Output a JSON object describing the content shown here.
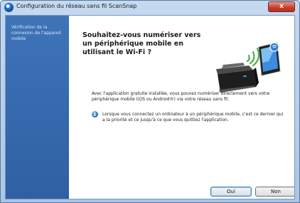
{
  "window": {
    "title": "Configuration du réseau sans fil ScanSnap",
    "close_label": "x"
  },
  "sidebar": {
    "items": [
      {
        "label": "Vérification de la connexion de l'appareil mobile"
      }
    ]
  },
  "main": {
    "heading": "Souhaitez-vous numériser vers un périphérique mobile en utilisant le Wi-Fi ?",
    "paragraph": "Avec l'application gratuite installée, vous pouvez numériser directement vers votre périphérique mobile (iOS ou Android®) via votre réseau sans fil.",
    "info_text": "Lorsque vous connectez un ordinateur à un périphérique mobile, c'est ce dernier qui a la priorité et ce jusqu'à ce que vous quittiez l'application.",
    "info_icon_glyph": "i",
    "illustration": {
      "icons": [
        "scanner-icon",
        "wifi-waves-icon",
        "tablet-icon"
      ],
      "colors": {
        "scanner": "#2b2b2b",
        "wifi": "#4db04a",
        "tablet_screen": "#3a8de0"
      }
    }
  },
  "buttons": {
    "yes_label": "Oui",
    "no_label": "Non"
  },
  "colors": {
    "sidebar": "#3569ad",
    "accent": "#1e6fc0"
  }
}
